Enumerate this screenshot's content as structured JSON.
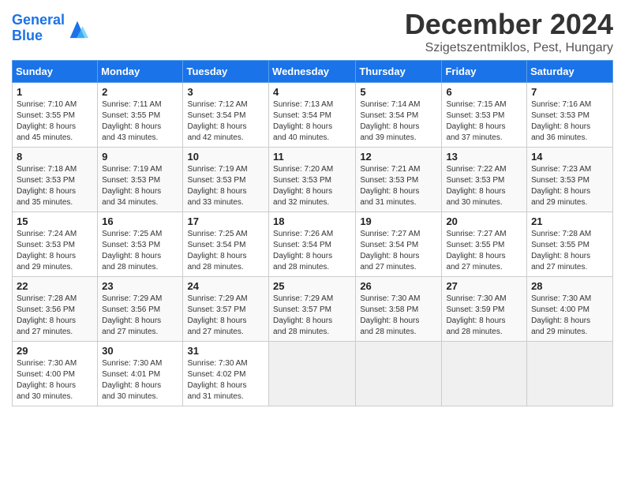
{
  "header": {
    "logo_line1": "General",
    "logo_line2": "Blue",
    "month": "December 2024",
    "location": "Szigetszentmiklos, Pest, Hungary"
  },
  "days_header": [
    "Sunday",
    "Monday",
    "Tuesday",
    "Wednesday",
    "Thursday",
    "Friday",
    "Saturday"
  ],
  "weeks": [
    [
      {
        "day": 1,
        "info": "Sunrise: 7:10 AM\nSunset: 3:55 PM\nDaylight: 8 hours\nand 45 minutes."
      },
      {
        "day": 2,
        "info": "Sunrise: 7:11 AM\nSunset: 3:55 PM\nDaylight: 8 hours\nand 43 minutes."
      },
      {
        "day": 3,
        "info": "Sunrise: 7:12 AM\nSunset: 3:54 PM\nDaylight: 8 hours\nand 42 minutes."
      },
      {
        "day": 4,
        "info": "Sunrise: 7:13 AM\nSunset: 3:54 PM\nDaylight: 8 hours\nand 40 minutes."
      },
      {
        "day": 5,
        "info": "Sunrise: 7:14 AM\nSunset: 3:54 PM\nDaylight: 8 hours\nand 39 minutes."
      },
      {
        "day": 6,
        "info": "Sunrise: 7:15 AM\nSunset: 3:53 PM\nDaylight: 8 hours\nand 37 minutes."
      },
      {
        "day": 7,
        "info": "Sunrise: 7:16 AM\nSunset: 3:53 PM\nDaylight: 8 hours\nand 36 minutes."
      }
    ],
    [
      {
        "day": 8,
        "info": "Sunrise: 7:18 AM\nSunset: 3:53 PM\nDaylight: 8 hours\nand 35 minutes."
      },
      {
        "day": 9,
        "info": "Sunrise: 7:19 AM\nSunset: 3:53 PM\nDaylight: 8 hours\nand 34 minutes."
      },
      {
        "day": 10,
        "info": "Sunrise: 7:19 AM\nSunset: 3:53 PM\nDaylight: 8 hours\nand 33 minutes."
      },
      {
        "day": 11,
        "info": "Sunrise: 7:20 AM\nSunset: 3:53 PM\nDaylight: 8 hours\nand 32 minutes."
      },
      {
        "day": 12,
        "info": "Sunrise: 7:21 AM\nSunset: 3:53 PM\nDaylight: 8 hours\nand 31 minutes."
      },
      {
        "day": 13,
        "info": "Sunrise: 7:22 AM\nSunset: 3:53 PM\nDaylight: 8 hours\nand 30 minutes."
      },
      {
        "day": 14,
        "info": "Sunrise: 7:23 AM\nSunset: 3:53 PM\nDaylight: 8 hours\nand 29 minutes."
      }
    ],
    [
      {
        "day": 15,
        "info": "Sunrise: 7:24 AM\nSunset: 3:53 PM\nDaylight: 8 hours\nand 29 minutes."
      },
      {
        "day": 16,
        "info": "Sunrise: 7:25 AM\nSunset: 3:53 PM\nDaylight: 8 hours\nand 28 minutes."
      },
      {
        "day": 17,
        "info": "Sunrise: 7:25 AM\nSunset: 3:54 PM\nDaylight: 8 hours\nand 28 minutes."
      },
      {
        "day": 18,
        "info": "Sunrise: 7:26 AM\nSunset: 3:54 PM\nDaylight: 8 hours\nand 28 minutes."
      },
      {
        "day": 19,
        "info": "Sunrise: 7:27 AM\nSunset: 3:54 PM\nDaylight: 8 hours\nand 27 minutes."
      },
      {
        "day": 20,
        "info": "Sunrise: 7:27 AM\nSunset: 3:55 PM\nDaylight: 8 hours\nand 27 minutes."
      },
      {
        "day": 21,
        "info": "Sunrise: 7:28 AM\nSunset: 3:55 PM\nDaylight: 8 hours\nand 27 minutes."
      }
    ],
    [
      {
        "day": 22,
        "info": "Sunrise: 7:28 AM\nSunset: 3:56 PM\nDaylight: 8 hours\nand 27 minutes."
      },
      {
        "day": 23,
        "info": "Sunrise: 7:29 AM\nSunset: 3:56 PM\nDaylight: 8 hours\nand 27 minutes."
      },
      {
        "day": 24,
        "info": "Sunrise: 7:29 AM\nSunset: 3:57 PM\nDaylight: 8 hours\nand 27 minutes."
      },
      {
        "day": 25,
        "info": "Sunrise: 7:29 AM\nSunset: 3:57 PM\nDaylight: 8 hours\nand 28 minutes."
      },
      {
        "day": 26,
        "info": "Sunrise: 7:30 AM\nSunset: 3:58 PM\nDaylight: 8 hours\nand 28 minutes."
      },
      {
        "day": 27,
        "info": "Sunrise: 7:30 AM\nSunset: 3:59 PM\nDaylight: 8 hours\nand 28 minutes."
      },
      {
        "day": 28,
        "info": "Sunrise: 7:30 AM\nSunset: 4:00 PM\nDaylight: 8 hours\nand 29 minutes."
      }
    ],
    [
      {
        "day": 29,
        "info": "Sunrise: 7:30 AM\nSunset: 4:00 PM\nDaylight: 8 hours\nand 30 minutes."
      },
      {
        "day": 30,
        "info": "Sunrise: 7:30 AM\nSunset: 4:01 PM\nDaylight: 8 hours\nand 30 minutes."
      },
      {
        "day": 31,
        "info": "Sunrise: 7:30 AM\nSunset: 4:02 PM\nDaylight: 8 hours\nand 31 minutes."
      },
      null,
      null,
      null,
      null
    ]
  ]
}
